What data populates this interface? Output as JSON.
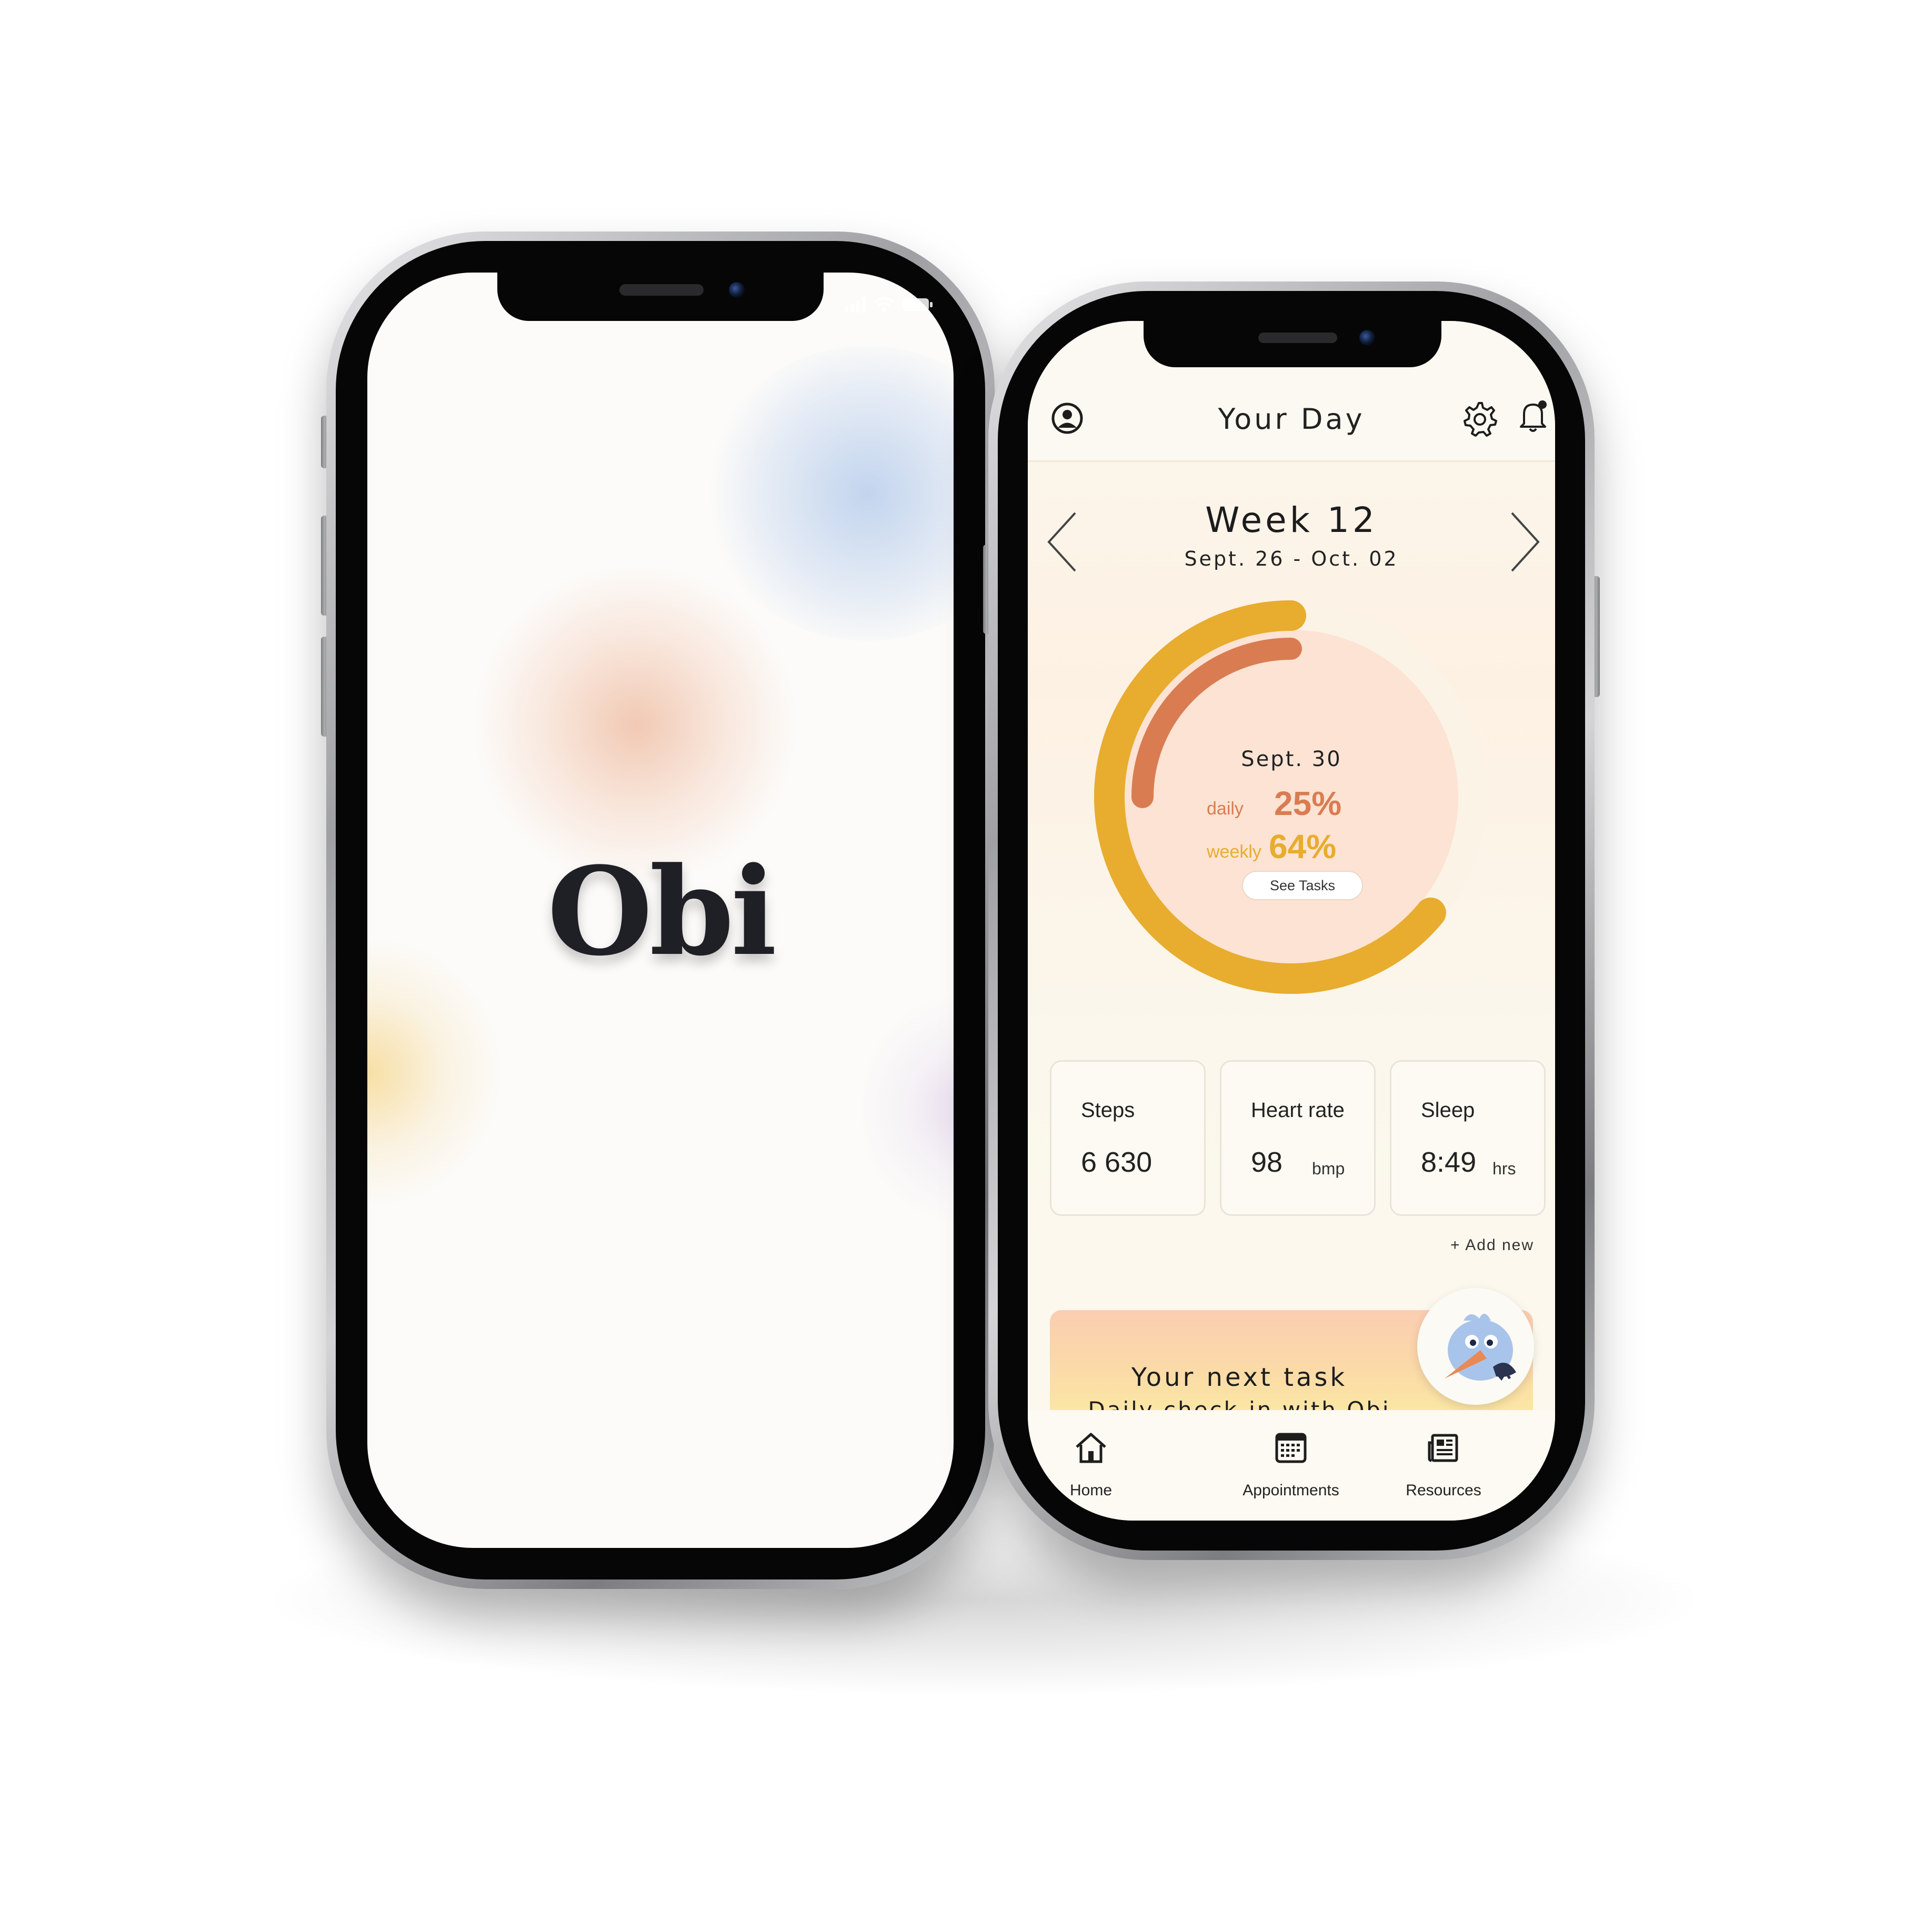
{
  "splash": {
    "logo": "Obi"
  },
  "dashboard": {
    "header": {
      "title": "Your Day",
      "profile_icon": "profile-icon",
      "settings_icon": "gear-icon",
      "notification_icon": "bell-icon"
    },
    "week": {
      "title": "Week 12",
      "range": "Sept. 26 - Oct. 02"
    },
    "progress": {
      "date": "Sept. 30",
      "daily_label": "daily",
      "daily_value": "25%",
      "daily_fraction": 0.25,
      "weekly_label": "weekly",
      "weekly_value": "64%",
      "weekly_fraction": 0.64,
      "see_tasks_label": "See Tasks",
      "colors": {
        "daily": "#d97c52",
        "weekly": "#e8ac2e",
        "inner": "#fce3d3"
      }
    },
    "stats": [
      {
        "label": "Steps",
        "value": "6 630",
        "unit": ""
      },
      {
        "label": "Heart rate",
        "value": "98",
        "unit": "bmp"
      },
      {
        "label": "Sleep",
        "value": "8:49",
        "unit": "hrs"
      }
    ],
    "add_new_label": "+ Add new",
    "next_task": {
      "heading": "Your next task",
      "link": "Daily check-in with Obi",
      "mascot_icon": "bird-mascot-icon"
    },
    "bottom_nav": [
      {
        "label": "Home",
        "icon": "home-icon"
      },
      {
        "label": "Appointments",
        "icon": "calendar-icon"
      },
      {
        "label": "Resources",
        "icon": "newspaper-icon"
      }
    ]
  }
}
